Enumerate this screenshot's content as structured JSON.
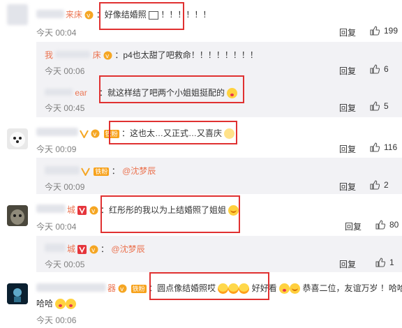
{
  "comments": [
    {
      "text": "：好像结婚照",
      "tail": "！！！！！！",
      "time": "今天 00:04",
      "reply": "回复",
      "likes": "199",
      "name_frag": "来床"
    },
    {
      "prefix": "我",
      "name_frag": "床",
      "text": "：p4也太甜了吧救命！！！！！！！！",
      "time": "今天 00:06",
      "reply": "回复",
      "likes": "6"
    },
    {
      "name_frag": "ear",
      "text": "：就这样结了吧两个小姐姐挺配的",
      "time": "今天 00:45",
      "reply": "回复",
      "likes": "5"
    },
    {
      "fan_label": "铁粉",
      "text": "：这也太…又正式…又喜庆",
      "time": "今天 00:09",
      "reply": "回复",
      "likes": "116"
    },
    {
      "fan_label": "铁粉",
      "text": "：",
      "mention": "@沈梦辰",
      "time": "今天 00:09",
      "reply": "回复",
      "likes": "2"
    },
    {
      "name_frag": "城",
      "text": "：红彤彤的我以为上结婚照了姐姐",
      "time": "今天 00:04",
      "reply": "回复",
      "likes": "80"
    },
    {
      "name_frag": "城",
      "text": "：",
      "mention": "@沈梦辰",
      "time": "今天 00:05",
      "reply": "回复",
      "likes": "1"
    },
    {
      "name_frag": "器",
      "fan_label": "铁粉",
      "text1": "：圆点像结婚照哎",
      "text2": "好好看",
      "text3": "恭喜二位，友谊万岁",
      "text4": "！哈哈",
      "text5": "哈哈",
      "time": "今天 00:06"
    }
  ]
}
